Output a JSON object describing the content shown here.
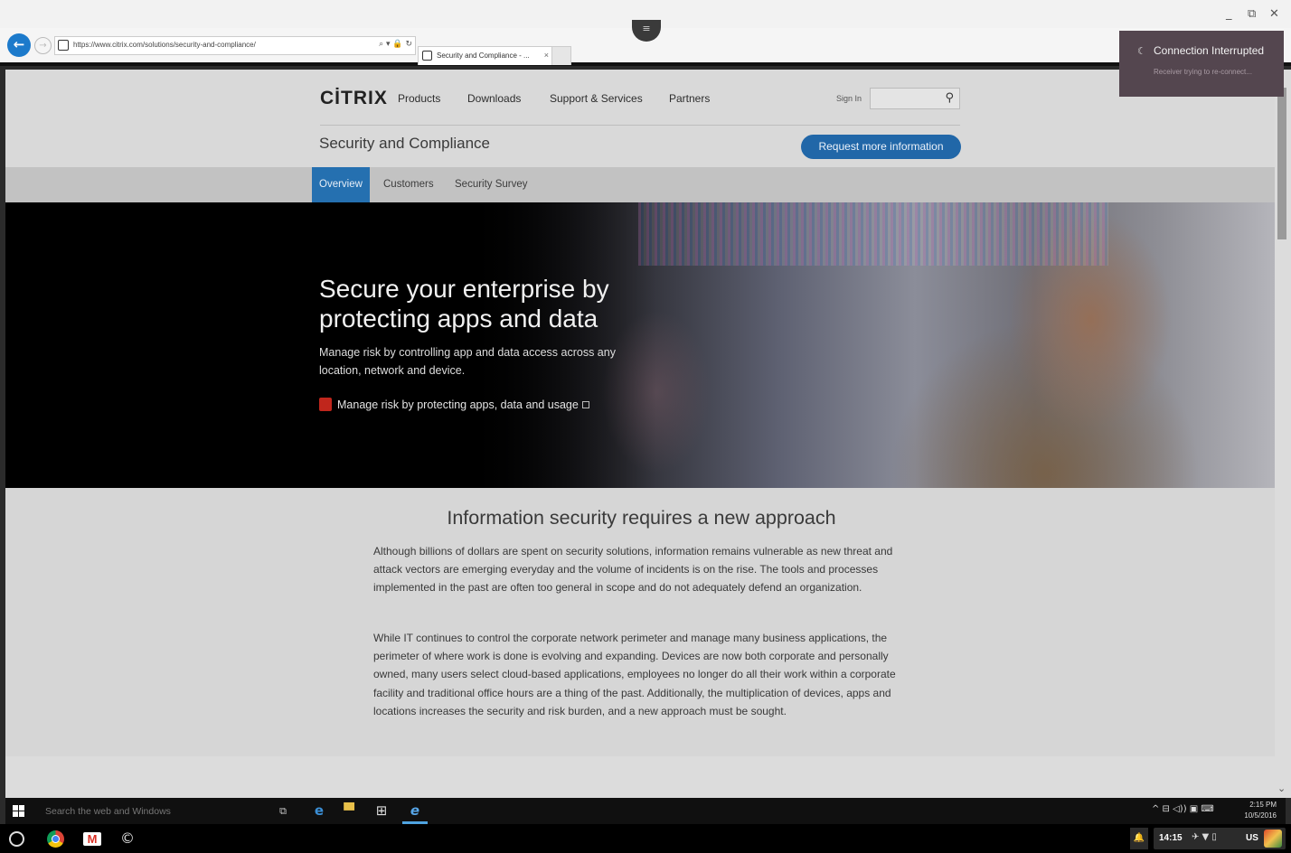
{
  "window": {
    "controls": [
      "_",
      "⧉",
      "✕"
    ],
    "handle_icon": "≡"
  },
  "browser": {
    "back_icon": "←",
    "forward_icon": "→",
    "url": "https://www.citrix.com/solutions/security-and-compliance/",
    "address_tools": "⌕ ▾ 🔒 ↻",
    "tab_title": "Security and Compliance - ...",
    "tab_close": "×"
  },
  "site": {
    "logo": "CİTRIX",
    "nav": [
      "Products",
      "Downloads",
      "Support & Services",
      "Partners"
    ],
    "signin": "Sign In",
    "search_placeholder": "",
    "search_icon": "🔍",
    "section_title": "Security and Compliance",
    "request_button": "Request more information",
    "subnav": [
      "Overview",
      "Customers",
      "Security Survey"
    ]
  },
  "hero": {
    "heading": "Secure your enterprise by protecting apps and data",
    "subheading": "Manage risk by controlling app and data access across any location, network and device.",
    "pdf_link": "Manage risk by protecting apps, data and usage"
  },
  "content": {
    "heading": "Information security requires a new approach",
    "paragraphs": [
      "Although billions of dollars are spent on security solutions, information remains vulnerable as new threat and attack vectors are emerging everyday and the volume of incidents is on the rise. The tools and processes implemented in the past are often too general in scope and do not adequately defend an organization.",
      "While IT continues to control the corporate network perimeter and manage many business applications, the perimeter of where work is done is evolving and expanding. Devices are now both corporate and personally owned, many users select cloud-based applications, employees no longer do all their work within a corporate facility and traditional office hours are a thing of the past. Additionally, the multiplication of devices, apps and locations increases the security and risk burden, and a new approach must be sought."
    ]
  },
  "toast": {
    "icon": "☾",
    "title": "Connection Interrupted",
    "message": "Receiver trying to re-connect..."
  },
  "taskbar": {
    "search": "Search the web and Windows",
    "time": "2:15 PM",
    "date": "10/5/2016",
    "tray_icons": "^ ⊟ ◁)) ▣ ⌨"
  },
  "shelf": {
    "time": "14:15",
    "indicators": "✈ ▼ ▯",
    "locale": "US",
    "bell": "🔔",
    "receiver_icon": "©"
  },
  "colors": {
    "accent_blue": "#2167a8",
    "subnav_active": "#2570b0",
    "toast_bg": "#54464f",
    "pdf_red": "#c0261c"
  }
}
